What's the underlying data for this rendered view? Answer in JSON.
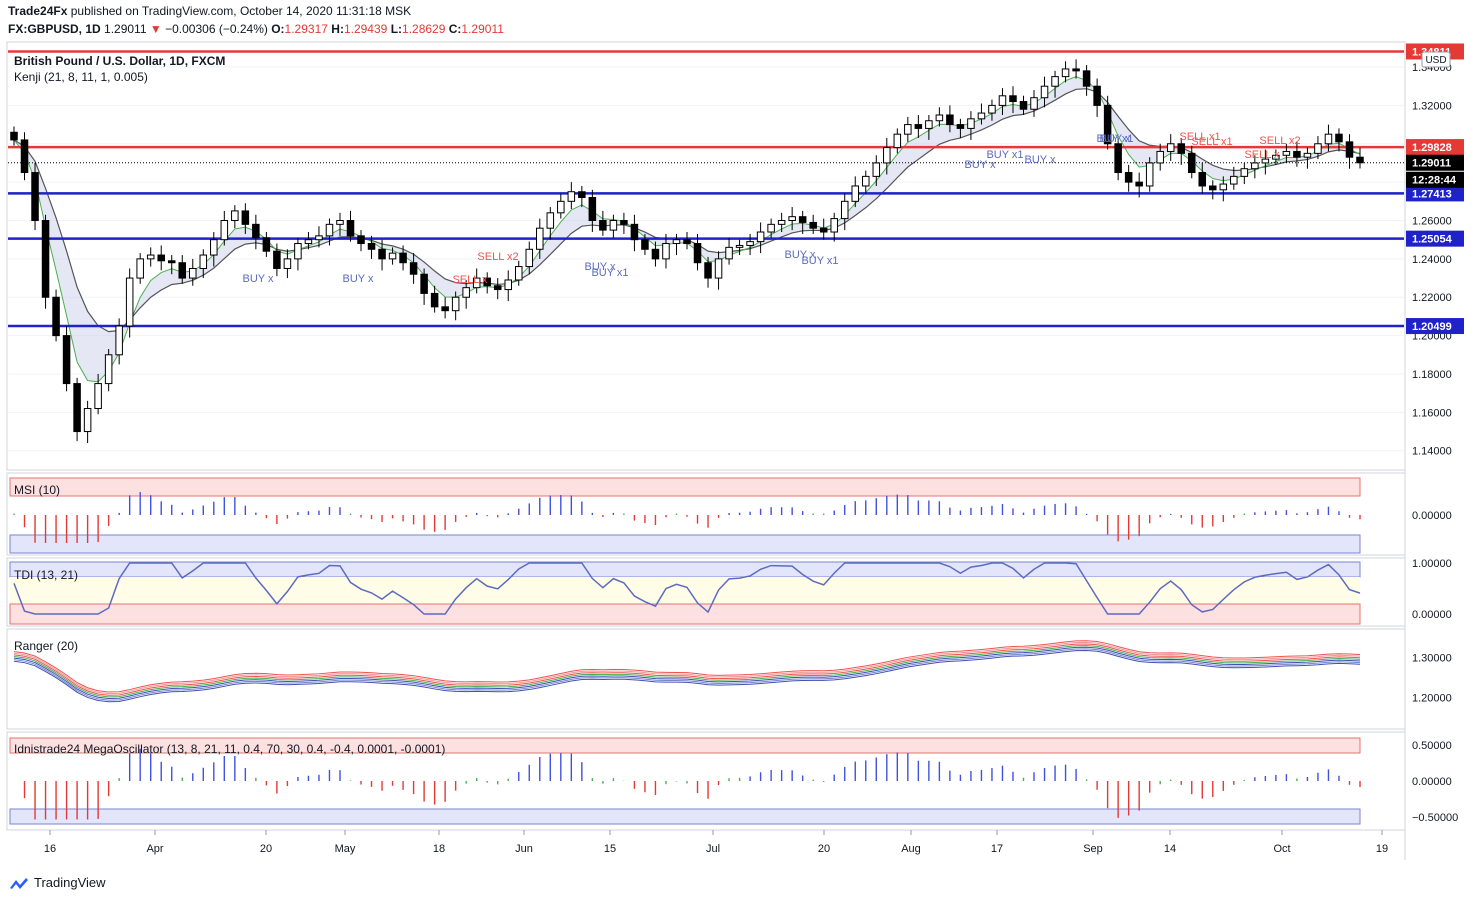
{
  "header": {
    "publisher": "Trade24Fx",
    "published_text": "published on TradingView.com, October 14, 2020 11:31:18 MSK",
    "symbol": "FX:GBPUSD, 1D",
    "last": "1.29011",
    "change": "−0.00306 (−0.24%)",
    "o_label": "O:",
    "o": "1.29317",
    "h_label": "H:",
    "h": "1.29439",
    "l_label": "L:",
    "l": "1.28629",
    "c_label": "C:",
    "c": "1.29011"
  },
  "main_pane": {
    "title": "British Pound / U.S. Dollar, 1D, FXCM",
    "indicator": "Kenji (21, 8, 11, 1, 0.005)",
    "currency": "USD"
  },
  "panes": {
    "msi": "MSI (10)",
    "tdi": "TDI (13, 21)",
    "ranger": "Ranger (20)",
    "mega": "Idnistrade24 MegaOscillator (13, 8, 21, 11, 0.4, 70, 30, 0.4, -0.4, 0.0001, -0.0001)"
  },
  "footer": {
    "brand": "TradingView"
  },
  "chart_data": {
    "type": "candlestick",
    "y_ticks": [
      "1.14000",
      "1.16000",
      "1.18000",
      "1.20000",
      "1.22000",
      "1.24000",
      "1.26000",
      "1.28000",
      "1.30000",
      "1.32000",
      "1.34000"
    ],
    "ylim": [
      1.131,
      1.352
    ],
    "x_labels": [
      "16",
      "Apr",
      "20",
      "May",
      "18",
      "Jun",
      "15",
      "Jul",
      "20",
      "Aug",
      "17",
      "Sep",
      "14",
      "Oct",
      "19"
    ],
    "levels": [
      {
        "value": 1.3481,
        "label": "1.34811",
        "color": "#e53935"
      },
      {
        "value": 1.29828,
        "label": "1.29828",
        "color": "#e53935"
      },
      {
        "value": 1.29011,
        "label": "1.29011",
        "color": "#000000"
      },
      {
        "value": 1.27413,
        "label": "1.27413",
        "color": "#1e22c8"
      },
      {
        "value": 1.25054,
        "label": "1.25054",
        "color": "#1e22c8"
      },
      {
        "value": 1.20499,
        "label": "1.20499",
        "color": "#1e22c8"
      }
    ],
    "countdown": "12:28:44",
    "closes": [
      1.302,
      1.285,
      1.26,
      1.22,
      1.2,
      1.175,
      1.15,
      1.162,
      1.175,
      1.19,
      1.205,
      1.23,
      1.24,
      1.242,
      1.239,
      1.238,
      1.23,
      1.235,
      1.242,
      1.25,
      1.26,
      1.265,
      1.258,
      1.251,
      1.244,
      1.235,
      1.24,
      1.248,
      1.25,
      1.252,
      1.258,
      1.26,
      1.252,
      1.248,
      1.245,
      1.24,
      1.243,
      1.238,
      1.232,
      1.222,
      1.215,
      1.213,
      1.22,
      1.225,
      1.23,
      1.226,
      1.224,
      1.229,
      1.236,
      1.245,
      1.256,
      1.264,
      1.27,
      1.275,
      1.272,
      1.26,
      1.255,
      1.26,
      1.258,
      1.25,
      1.245,
      1.24,
      1.248,
      1.25,
      1.248,
      1.238,
      1.23,
      1.24,
      1.246,
      1.247,
      1.249,
      1.254,
      1.258,
      1.26,
      1.262,
      1.259,
      1.256,
      1.254,
      1.261,
      1.27,
      1.278,
      1.283,
      1.29,
      1.298,
      1.305,
      1.31,
      1.308,
      1.312,
      1.315,
      1.31,
      1.308,
      1.313,
      1.316,
      1.32,
      1.325,
      1.322,
      1.318,
      1.324,
      1.33,
      1.335,
      1.339,
      1.338,
      1.33,
      1.32,
      1.3,
      1.285,
      1.28,
      1.278,
      1.29,
      1.296,
      1.3,
      1.295,
      1.285,
      1.278,
      1.276,
      1.279,
      1.283,
      1.287,
      1.29,
      1.292,
      1.294,
      1.296,
      1.293,
      1.295,
      1.3,
      1.305,
      1.301,
      1.293,
      1.2901
    ],
    "tdi_ticks": [
      "1.00000",
      "0.00000"
    ],
    "ranger_ticks": [
      "1.30000",
      "1.20000"
    ],
    "msi_ticks": [
      "0.00000"
    ],
    "mega_ticks": [
      "0.50000",
      "0.00000",
      "−0.50000"
    ],
    "signal_labels": [
      "BUY x",
      "BUY x",
      "SELL x",
      "SELL x2",
      "BUY x",
      "BUY x1",
      "BUY x",
      "BUY x1",
      "BUY x",
      "BUY x1",
      "BUY x",
      "BUY x1",
      "BUY x",
      "SELL x1",
      "SELL x1",
      "SELL x",
      "SELL x2"
    ]
  }
}
